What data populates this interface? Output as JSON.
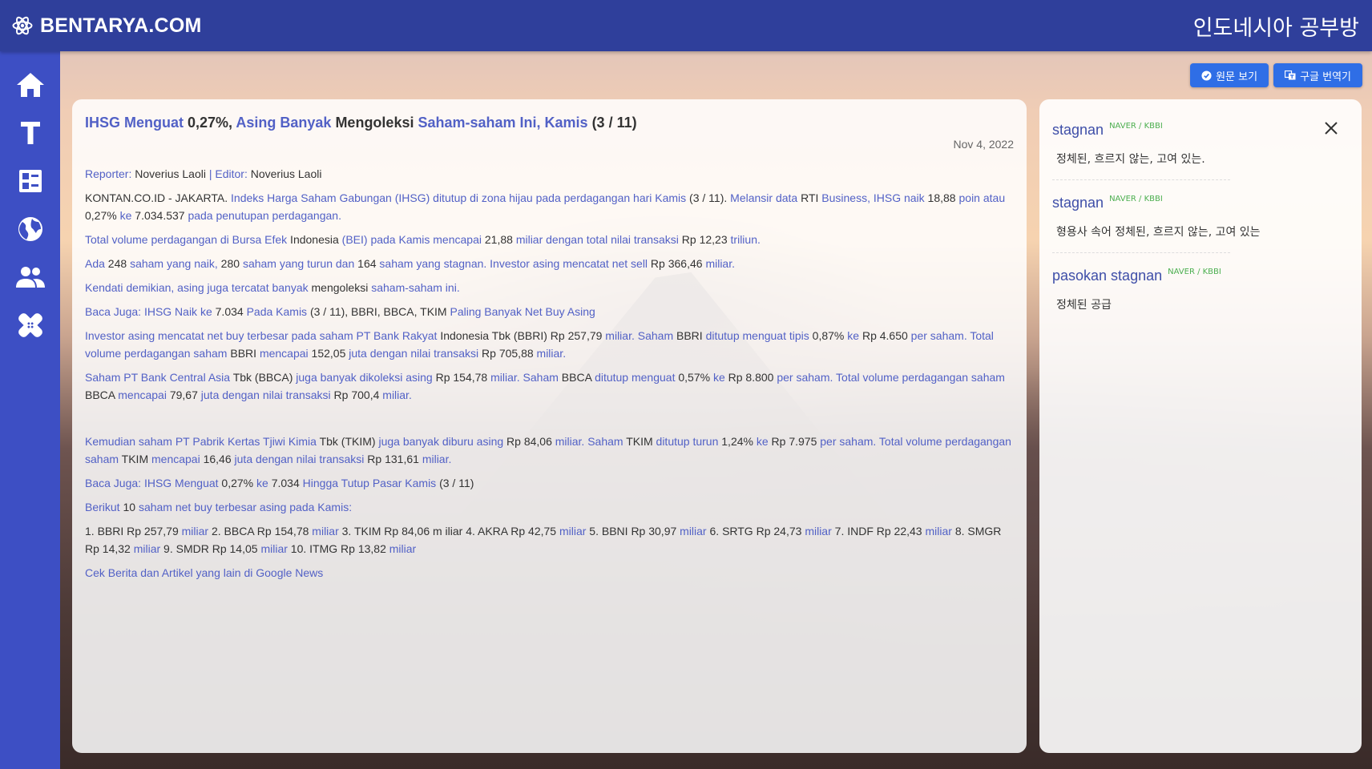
{
  "colors": {
    "topbar": "#2f3f9b",
    "sidebar": "#3d4fc4",
    "link": "#5261c6",
    "button": "#2f6ee6",
    "source": "#4caf50"
  },
  "header": {
    "brand": "BENTARYA.COM",
    "title": "인도네시아 공부방"
  },
  "sidebar": {
    "items": [
      {
        "icon": "home-icon"
      },
      {
        "icon": "text-icon"
      },
      {
        "icon": "dashboard-icon"
      },
      {
        "icon": "globe-icon"
      },
      {
        "icon": "people-icon"
      },
      {
        "icon": "bandage-icon"
      }
    ]
  },
  "toolbar": {
    "original_label": "원문 보기",
    "translate_label": "구글 번역기"
  },
  "article": {
    "title": [
      {
        "t": "IHSG Menguat",
        "c": "w"
      },
      {
        "t": " 0,27%, ",
        "c": "k"
      },
      {
        "t": "Asing Banyak",
        "c": "w"
      },
      {
        "t": " Mengoleksi ",
        "c": "k"
      },
      {
        "t": "Saham-saham Ini, Kamis",
        "c": "w"
      },
      {
        "t": " (3 / 11)",
        "c": "k"
      }
    ],
    "date": "Nov 4, 2022",
    "meta": [
      {
        "t": "Reporter:",
        "c": "w"
      },
      {
        "t": " Noverius Laoli ",
        "c": "k"
      },
      {
        "t": "|",
        "c": "w"
      },
      {
        "t": " ",
        "c": "k"
      },
      {
        "t": "Editor:",
        "c": "w"
      },
      {
        "t": " Noverius Laoli",
        "c": "k"
      }
    ],
    "paragraphs": [
      [
        {
          "t": "KONTAN.CO.ID -  JAKARTA. ",
          "c": "k"
        },
        {
          "t": "Indeks Harga Saham Gabungan (IHSG) ditutup di zona hijau pada perdagangan hari Kamis",
          "c": "w"
        },
        {
          "t": " (3 / 11). ",
          "c": "k"
        },
        {
          "t": "Melansir data",
          "c": "w"
        },
        {
          "t": " RTI ",
          "c": "k"
        },
        {
          "t": "Business, IHSG naik",
          "c": "w"
        },
        {
          "t": " 18,88 ",
          "c": "k"
        },
        {
          "t": "poin atau",
          "c": "w"
        },
        {
          "t": " 0,27% ",
          "c": "k"
        },
        {
          "t": "ke",
          "c": "w"
        },
        {
          "t": " 7.034.537 ",
          "c": "k"
        },
        {
          "t": "pada penutupan perdagangan.",
          "c": "w"
        }
      ],
      [
        {
          "t": "Total volume perdagangan di Bursa Efek",
          "c": "w"
        },
        {
          "t": " Indonesia ",
          "c": "k"
        },
        {
          "t": "(BEI) pada Kamis mencapai",
          "c": "w"
        },
        {
          "t": " 21,88 ",
          "c": "k"
        },
        {
          "t": "miliar dengan total nilai transaksi",
          "c": "w"
        },
        {
          "t": " Rp 12,23 ",
          "c": "k"
        },
        {
          "t": "triliun.",
          "c": "w"
        }
      ],
      [
        {
          "t": "Ada",
          "c": "w"
        },
        {
          "t": " 248 ",
          "c": "k"
        },
        {
          "t": "saham yang naik,",
          "c": "w"
        },
        {
          "t": " 280 ",
          "c": "k"
        },
        {
          "t": "saham yang turun dan",
          "c": "w"
        },
        {
          "t": " 164 ",
          "c": "k"
        },
        {
          "t": "saham yang stagnan. Investor asing mencatat net sell",
          "c": "w"
        },
        {
          "t": " Rp 366,46 ",
          "c": "k"
        },
        {
          "t": "miliar.",
          "c": "w"
        }
      ],
      [
        {
          "t": "Kendati demikian, asing juga tercatat banyak",
          "c": "w"
        },
        {
          "t": " mengoleksi ",
          "c": "k"
        },
        {
          "t": "saham-saham ini.",
          "c": "w"
        }
      ],
      [
        {
          "t": "Baca Juga: IHSG Naik ke",
          "c": "w"
        },
        {
          "t": " 7.034 ",
          "c": "k"
        },
        {
          "t": "Pada Kamis",
          "c": "w"
        },
        {
          "t": " (3 / 11), BBRI, BBCA, TKIM ",
          "c": "k"
        },
        {
          "t": "Paling Banyak Net Buy Asing",
          "c": "w"
        }
      ],
      [
        {
          "t": "Investor asing mencatat net buy terbesar pada saham PT Bank Rakyat",
          "c": "w"
        },
        {
          "t": " Indonesia Tbk (BBRI) Rp 257,79 ",
          "c": "k"
        },
        {
          "t": "miliar. Saham",
          "c": "w"
        },
        {
          "t": " BBRI ",
          "c": "k"
        },
        {
          "t": "ditutup menguat tipis",
          "c": "w"
        },
        {
          "t": " 0,87% ",
          "c": "k"
        },
        {
          "t": "ke",
          "c": "w"
        },
        {
          "t": " Rp 4.650 ",
          "c": "k"
        },
        {
          "t": "per saham. Total volume perdagangan saham",
          "c": "w"
        },
        {
          "t": " BBRI ",
          "c": "k"
        },
        {
          "t": "mencapai",
          "c": "w"
        },
        {
          "t": " 152,05 ",
          "c": "k"
        },
        {
          "t": "juta dengan nilai transaksi",
          "c": "w"
        },
        {
          "t": " Rp 705,88 ",
          "c": "k"
        },
        {
          "t": "miliar.",
          "c": "w"
        }
      ],
      [
        {
          "t": "Saham PT Bank Central Asia",
          "c": "w"
        },
        {
          "t": " Tbk (BBCA) ",
          "c": "k"
        },
        {
          "t": "juga banyak dikoleksi asing",
          "c": "w"
        },
        {
          "t": " Rp 154,78 ",
          "c": "k"
        },
        {
          "t": "miliar. Saham",
          "c": "w"
        },
        {
          "t": " BBCA ",
          "c": "k"
        },
        {
          "t": "ditutup menguat",
          "c": "w"
        },
        {
          "t": " 0,57% ",
          "c": "k"
        },
        {
          "t": "ke",
          "c": "w"
        },
        {
          "t": " Rp 8.800 ",
          "c": "k"
        },
        {
          "t": "per saham. Total volume perdagangan saham",
          "c": "w"
        },
        {
          "t": " BBCA ",
          "c": "k"
        },
        {
          "t": "mencapai",
          "c": "w"
        },
        {
          "t": " 79,67 ",
          "c": "k"
        },
        {
          "t": "juta dengan nilai transaksi",
          "c": "w"
        },
        {
          "t": " Rp 700,4 ",
          "c": "k"
        },
        {
          "t": "miliar.",
          "c": "w"
        }
      ],
      [],
      [
        {
          "t": "Kemudian saham PT Pabrik Kertas Tjiwi Kimia",
          "c": "w"
        },
        {
          "t": " Tbk (TKIM) ",
          "c": "k"
        },
        {
          "t": "juga banyak diburu asing",
          "c": "w"
        },
        {
          "t": " Rp 84,06 ",
          "c": "k"
        },
        {
          "t": "miliar. Saham",
          "c": "w"
        },
        {
          "t": " TKIM ",
          "c": "k"
        },
        {
          "t": "ditutup turun",
          "c": "w"
        },
        {
          "t": " 1,24% ",
          "c": "k"
        },
        {
          "t": "ke",
          "c": "w"
        },
        {
          "t": " Rp 7.975 ",
          "c": "k"
        },
        {
          "t": "per saham. Total volume perdagangan saham",
          "c": "w"
        },
        {
          "t": " TKIM ",
          "c": "k"
        },
        {
          "t": "mencapai",
          "c": "w"
        },
        {
          "t": " 16,46 ",
          "c": "k"
        },
        {
          "t": "juta dengan nilai transaksi",
          "c": "w"
        },
        {
          "t": " Rp 131,61 ",
          "c": "k"
        },
        {
          "t": "miliar.",
          "c": "w"
        }
      ],
      [
        {
          "t": "Baca Juga: IHSG Menguat",
          "c": "w"
        },
        {
          "t": " 0,27% ",
          "c": "k"
        },
        {
          "t": "ke",
          "c": "w"
        },
        {
          "t": " 7.034 ",
          "c": "k"
        },
        {
          "t": "Hingga Tutup Pasar Kamis",
          "c": "w"
        },
        {
          "t": " (3 / 11)",
          "c": "k"
        }
      ],
      [
        {
          "t": "Berikut",
          "c": "w"
        },
        {
          "t": " 10 ",
          "c": "k"
        },
        {
          "t": "saham net buy terbesar asing pada Kamis:",
          "c": "w"
        }
      ],
      [
        {
          "t": "1. BBRI Rp 257,79 ",
          "c": "k"
        },
        {
          "t": "miliar",
          "c": "w"
        },
        {
          "t": " 2. BBCA Rp 154,78 ",
          "c": "k"
        },
        {
          "t": "miliar",
          "c": "w"
        },
        {
          "t": " 3. TKIM Rp 84,06 m iliar 4. AKRA Rp 42,75 ",
          "c": "k"
        },
        {
          "t": "miliar",
          "c": "w"
        },
        {
          "t": " 5. BBNI Rp 30,97 ",
          "c": "k"
        },
        {
          "t": "miliar",
          "c": "w"
        },
        {
          "t": " 6. SRTG Rp 24,73 ",
          "c": "k"
        },
        {
          "t": "miliar",
          "c": "w"
        },
        {
          "t": " 7. INDF Rp 22,43 ",
          "c": "k"
        },
        {
          "t": "miliar",
          "c": "w"
        },
        {
          "t": " 8. SMGR Rp 14,32 ",
          "c": "k"
        },
        {
          "t": "miliar",
          "c": "w"
        },
        {
          "t": " 9. SMDR Rp 14,05 ",
          "c": "k"
        },
        {
          "t": "miliar",
          "c": "w"
        },
        {
          "t": " 10. ITMG Rp 13,82 ",
          "c": "k"
        },
        {
          "t": "miliar",
          "c": "w"
        }
      ],
      [
        {
          "t": "Cek Berita dan Artikel yang lain di Google News",
          "c": "w"
        }
      ]
    ]
  },
  "dictionary": {
    "entries": [
      {
        "word": "stagnan",
        "source": "NAVER / KBBI",
        "definition": "정체된, 흐르지 않는, 고여 있는."
      },
      {
        "word": "stagnan",
        "source": "NAVER / KBBI",
        "definition": "형용사 속어 정체된, 흐르지 않는, 고여 있는"
      },
      {
        "word": "pasokan stagnan",
        "source": "NAVER / KBBI",
        "definition": "정체된 공급"
      }
    ]
  }
}
